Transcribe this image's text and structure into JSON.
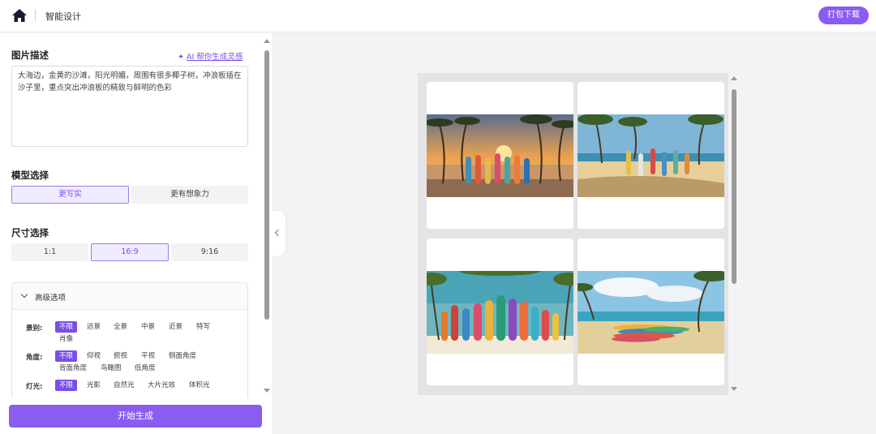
{
  "header": {
    "app_title": "智能设计",
    "download_label": "打包下载"
  },
  "description": {
    "title": "图片描述",
    "ai_link": "AI 帮你生成灵感",
    "prompt": "大海边，金黄的沙滩，阳光明媚，周围有很多椰子树，冲浪板插在沙子里，重点突出冲浪板的精致与鲜明的色彩"
  },
  "model": {
    "title": "模型选择",
    "options": [
      "更写实",
      "更有想象力"
    ],
    "selected": "更写实"
  },
  "size": {
    "title": "尺寸选择",
    "options": [
      "1:1",
      "16:9",
      "9:16"
    ],
    "selected": "16:9"
  },
  "advanced": {
    "title": "高级选项",
    "groups": [
      {
        "label": "景别:",
        "options": [
          "不限",
          "远景",
          "全景",
          "中景",
          "近景",
          "特写",
          "肖像"
        ],
        "selected": "不限"
      },
      {
        "label": "角度:",
        "options": [
          "不限",
          "仰视",
          "俯视",
          "平视",
          "侧面角度",
          "背面角度",
          "鸟瞰图",
          "低角度"
        ],
        "selected": "不限"
      },
      {
        "label": "灯光:",
        "options": [
          "不限",
          "光影",
          "自然光",
          "大片光效",
          "体积光"
        ],
        "selected": "不限"
      }
    ]
  },
  "start_label": "开始生成",
  "gallery": {
    "images": [
      {
        "name": "sunset-beach-surfboards"
      },
      {
        "name": "sunny-beach-surfboards"
      },
      {
        "name": "colorful-surfboards-palms"
      },
      {
        "name": "surfboards-on-sand"
      }
    ]
  },
  "colors": {
    "accent": "#8a5cf0",
    "accent_light": "#f1ebff",
    "canvas_bg": "#e4e4e6"
  }
}
